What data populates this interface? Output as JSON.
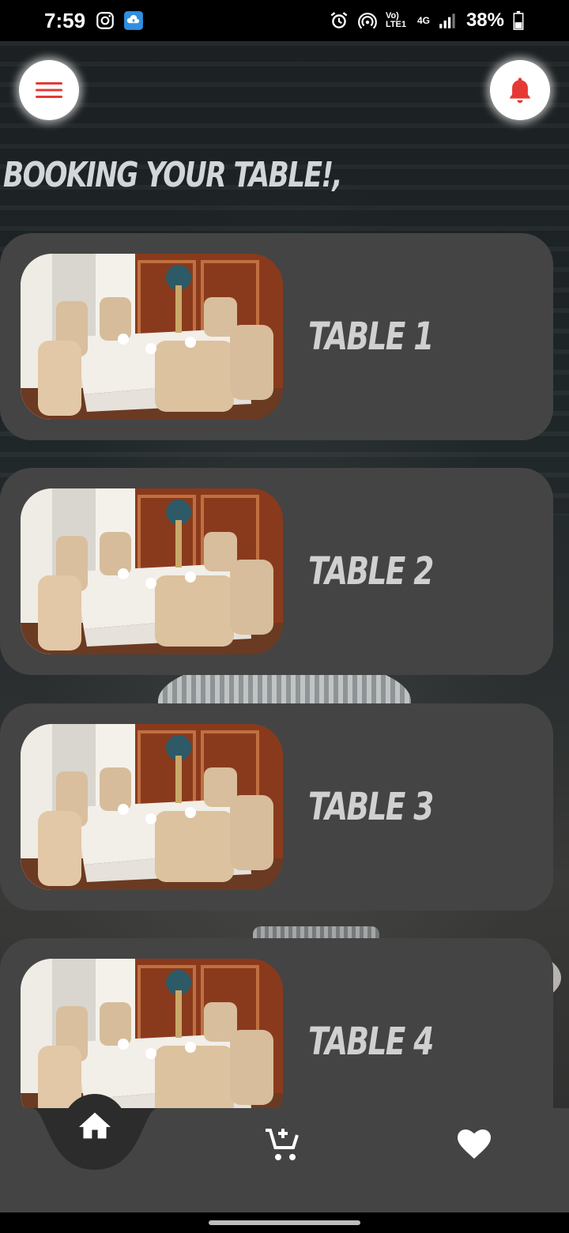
{
  "status_bar": {
    "time": "7:59",
    "left_icons": [
      "instagram-icon",
      "cloud-upload-icon"
    ],
    "right_icons": [
      "alarm-icon",
      "hotspot-icon",
      "volte-icon",
      "4g-icon",
      "signal-icon",
      "battery-icon"
    ],
    "volte_label": "Vo) LTE1",
    "network_label": "4G",
    "battery": "38%"
  },
  "header": {
    "menu_icon": "hamburger-menu-icon",
    "notification_icon": "bell-icon",
    "title": "BOOKING YOUR TABLE!,"
  },
  "tables": [
    {
      "label": "TABLE 1"
    },
    {
      "label": "TABLE 2"
    },
    {
      "label": "TABLE 3"
    },
    {
      "label": "TABLE 4"
    }
  ],
  "bottom_nav": {
    "items": [
      {
        "icon": "home-icon",
        "active": true
      },
      {
        "icon": "add-to-cart-icon",
        "active": false
      },
      {
        "icon": "heart-icon",
        "active": false
      }
    ]
  },
  "colors": {
    "accent": "#e53935",
    "card": "#444444",
    "title_text": "#d3d6d8"
  }
}
